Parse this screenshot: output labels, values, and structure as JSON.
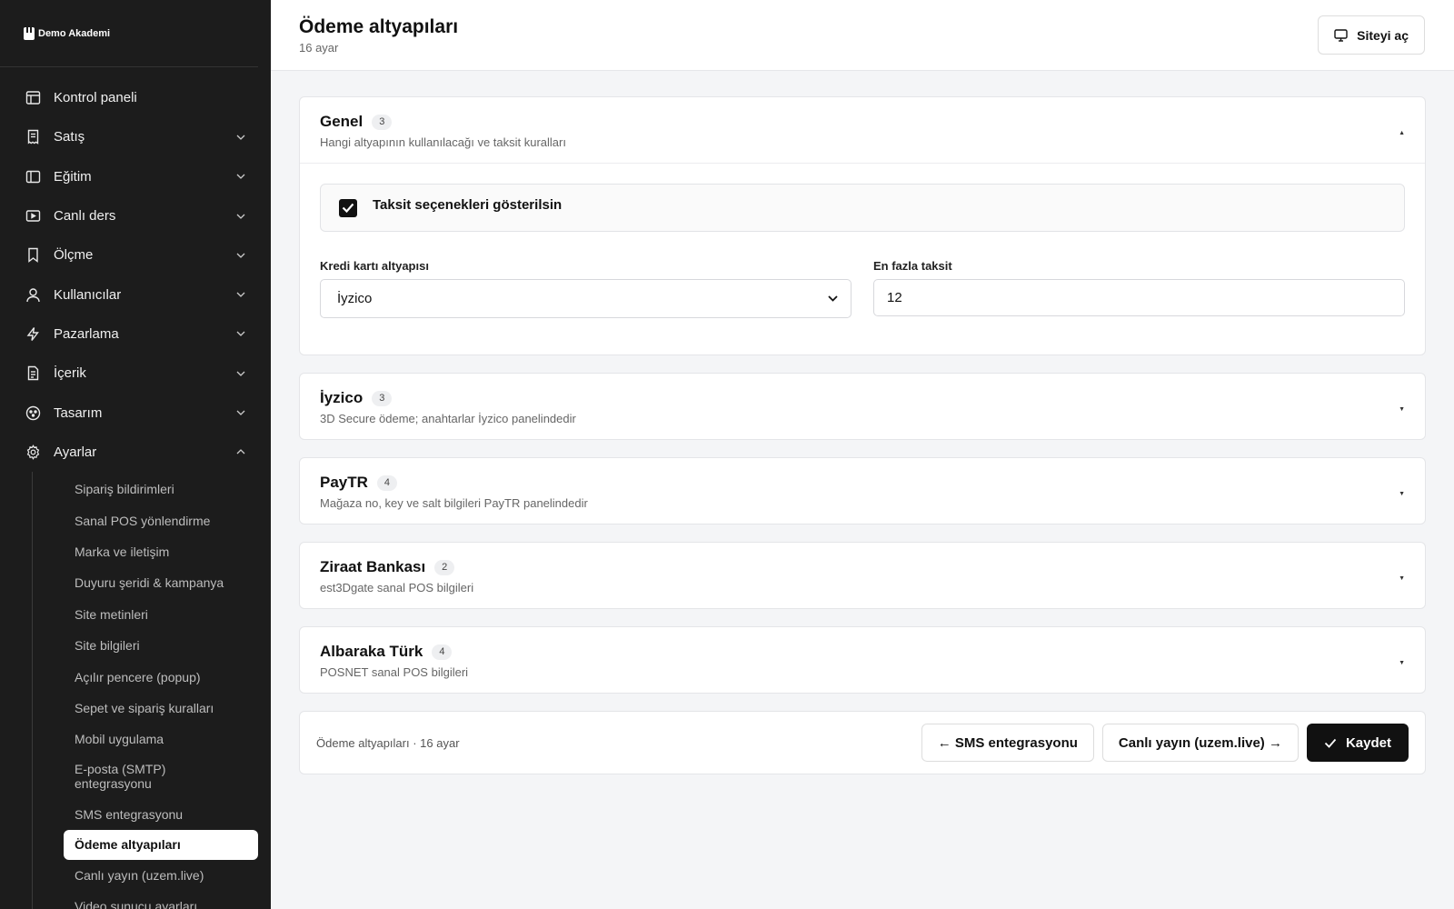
{
  "brand": {
    "name": "Demo Akademi"
  },
  "sidebar": {
    "items": [
      {
        "label": "Kontrol paneli",
        "icon": "layout-icon",
        "chevron": false
      },
      {
        "label": "Satış",
        "icon": "receipt-icon",
        "chevron": "down"
      },
      {
        "label": "Eğitim",
        "icon": "book-icon",
        "chevron": "down"
      },
      {
        "label": "Canlı ders",
        "icon": "video-icon",
        "chevron": "down"
      },
      {
        "label": "Ölçme",
        "icon": "bookmark-icon",
        "chevron": "down"
      },
      {
        "label": "Kullanıcılar",
        "icon": "user-icon",
        "chevron": "down"
      },
      {
        "label": "Pazarlama",
        "icon": "bolt-icon",
        "chevron": "down"
      },
      {
        "label": "İçerik",
        "icon": "file-icon",
        "chevron": "down"
      },
      {
        "label": "Tasarım",
        "icon": "palette-icon",
        "chevron": "down"
      },
      {
        "label": "Ayarlar",
        "icon": "gear-icon",
        "chevron": "up"
      }
    ],
    "settings_sub": [
      "Sipariş bildirimleri",
      "Sanal POS yönlendirme",
      "Marka ve iletişim",
      "Duyuru şeridi & kampanya",
      "Site metinleri",
      "Site bilgileri",
      "Açılır pencere (popup)",
      "Sepet ve sipariş kuralları",
      "Mobil uygulama",
      "E-posta (SMTP) entegrasyonu",
      "SMS entegrasyonu",
      "Ödeme altyapıları",
      "Canlı yayın (uzem.live)",
      "Video sunucu ayarları"
    ],
    "active_sub": "Ödeme altyapıları"
  },
  "header": {
    "title": "Ödeme altyapıları",
    "subtitle": "16 ayar",
    "open_site_label": "Siteyi aç"
  },
  "sections": [
    {
      "title": "Genel",
      "count": "3",
      "description": "Hangi altyapının kullanılacağı ve taksit kuralları",
      "expanded": true,
      "checkbox": {
        "label": "Taksit seçenekleri gösterilsin",
        "checked": true
      },
      "fields": [
        {
          "label": "Kredi kartı altyapısı",
          "type": "select",
          "value": "İyzico"
        },
        {
          "label": "En fazla taksit",
          "type": "input",
          "value": "12"
        }
      ]
    },
    {
      "title": "İyzico",
      "count": "3",
      "description": "3D Secure ödeme; anahtarlar İyzico panelindedir",
      "expanded": false
    },
    {
      "title": "PayTR",
      "count": "4",
      "description": "Mağaza no, key ve salt bilgileri PayTR panelindedir",
      "expanded": false
    },
    {
      "title": "Ziraat Bankası",
      "count": "2",
      "description": "est3Dgate sanal POS bilgileri",
      "expanded": false
    },
    {
      "title": "Albaraka Türk",
      "count": "4",
      "description": "POSNET sanal POS bilgileri",
      "expanded": false
    }
  ],
  "footer": {
    "summary": "Ödeme altyapıları · 16 ayar",
    "prev_label": "← SMS entegrasyonu",
    "next_label": "Canlı yayın (uzem.live) →",
    "save_label": "Kaydet"
  },
  "colors": {
    "sidebar_bg": "#1c1c1c",
    "primary": "#111111",
    "page_bg": "#f4f5f7"
  }
}
